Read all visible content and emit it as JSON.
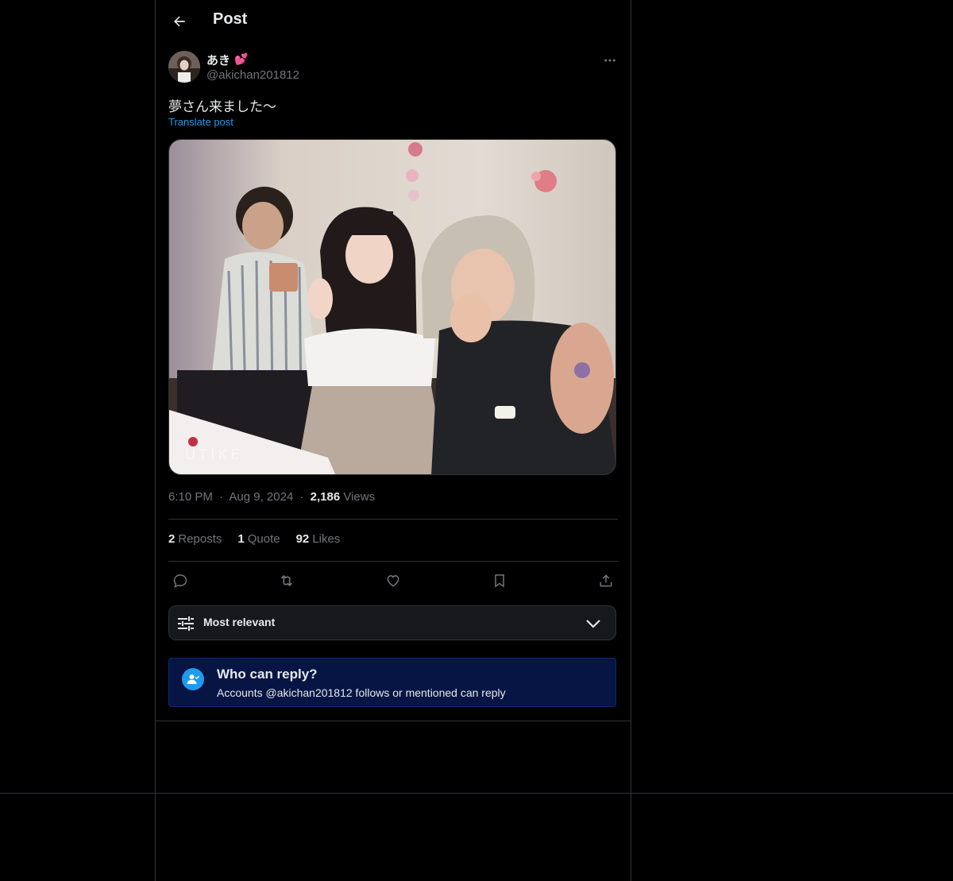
{
  "header": {
    "title": "Post"
  },
  "post": {
    "author": {
      "display_name": "あき",
      "name_emoji": "💕",
      "handle": "@akichan201812"
    },
    "text": "夢さん来ました〜",
    "translate_label": "Translate post",
    "media_watermark": "UTIKE",
    "time": "6:10 PM",
    "date": "Aug 9, 2024",
    "views_count": "2,186",
    "views_label": "Views",
    "separator": "·"
  },
  "stats": {
    "reposts_count": "2",
    "reposts_label": "Reposts",
    "quotes_count": "1",
    "quotes_label": "Quote",
    "likes_count": "92",
    "likes_label": "Likes"
  },
  "actions": [
    "reply-icon",
    "repost-icon",
    "like-icon",
    "bookmark-icon",
    "share-icon"
  ],
  "sort": {
    "label": "Most relevant"
  },
  "reply_restriction": {
    "title": "Who can reply?",
    "subtitle": "Accounts @akichan201812 follows or mentioned can reply"
  },
  "colors": {
    "background": "#000000",
    "accent": "#1d9bf0",
    "muted_text": "#71767b",
    "border": "#2f3336",
    "reply_box": "#061544"
  }
}
